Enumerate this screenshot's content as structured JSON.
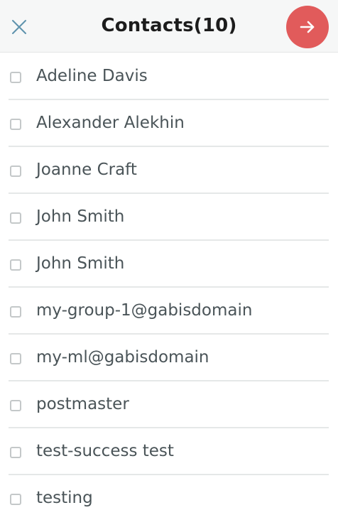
{
  "header": {
    "title": "Contacts(10)",
    "close_icon": "close-icon",
    "next_icon": "arrow-right-icon",
    "accent_color": "#e15b5b"
  },
  "contacts": [
    {
      "label": "Adeline Davis",
      "checked": false
    },
    {
      "label": "Alexander Alekhin",
      "checked": false
    },
    {
      "label": "Joanne Craft",
      "checked": false
    },
    {
      "label": "John Smith",
      "checked": false
    },
    {
      "label": "John Smith",
      "checked": false
    },
    {
      "label": "my-group-1@gabisdomain",
      "checked": false
    },
    {
      "label": "my-ml@gabisdomain",
      "checked": false
    },
    {
      "label": "postmaster",
      "checked": false
    },
    {
      "label": "test-success test",
      "checked": false
    },
    {
      "label": "testing",
      "checked": false
    }
  ]
}
